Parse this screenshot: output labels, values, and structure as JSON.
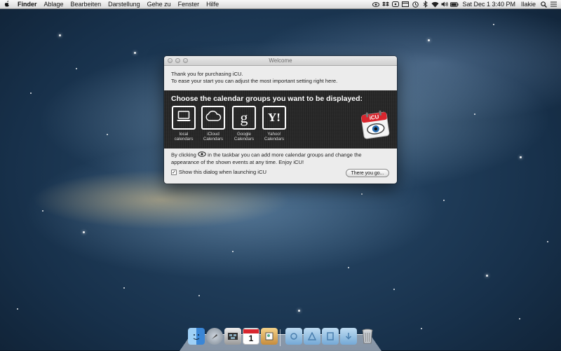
{
  "menubar": {
    "app": "Finder",
    "menus": [
      "Ablage",
      "Bearbeiten",
      "Darstellung",
      "Gehe zu",
      "Fenster",
      "Hilfe"
    ],
    "clock": "Sat Dec 1  3:40 PM",
    "user": "Ilakie",
    "status_icons": [
      "eye-icon",
      "dropbox-icon",
      "mail-icon",
      "window-icon",
      "history-icon",
      "bluetooth-icon",
      "wifi-icon",
      "volume-icon",
      "battery-icon"
    ]
  },
  "window": {
    "title": "Welcome",
    "intro_line1": "Thank you for purchasing iCU.",
    "intro_line2": "To ease your start you can adjust the most important setting right here.",
    "heading": "Choose the calendar groups you want to be displayed:",
    "logo_text": "iCU",
    "groups": [
      {
        "line1": "local",
        "line2": "calendars",
        "icon": "laptop-icon"
      },
      {
        "line1": "iCloud",
        "line2": "Calendars",
        "icon": "cloud-icon"
      },
      {
        "line1": "Google",
        "line2": "Calendars",
        "icon": "google-icon",
        "glyph": "g"
      },
      {
        "line1": "Yahoo!",
        "line2": "Calendars",
        "icon": "yahoo-icon",
        "glyph": "Y!"
      }
    ],
    "footer_part1": "By clicking",
    "footer_part2": "in the taskbar you can add more calendar groups and change the",
    "footer_line2": "appearance of the shown events at any time. Enjoy iCU!",
    "checkbox_label": "Show this dialog when launching iCU",
    "checkbox_checked": true,
    "checkbox_mark": "✓",
    "button_label": "There you go..."
  },
  "dock": {
    "calendar_day": "1",
    "icons": [
      "finder-icon",
      "launchpad-icon",
      "mission-control-icon",
      "calendar-icon",
      "preview-icon",
      "folder-icon",
      "applications-icon",
      "documents-icon",
      "downloads-icon",
      "trash-icon"
    ]
  },
  "colors": {
    "menubar": "#e6e6e6",
    "window_bg": "#ececec",
    "band_bg": "#222222",
    "logo_red": "#d8262e"
  }
}
